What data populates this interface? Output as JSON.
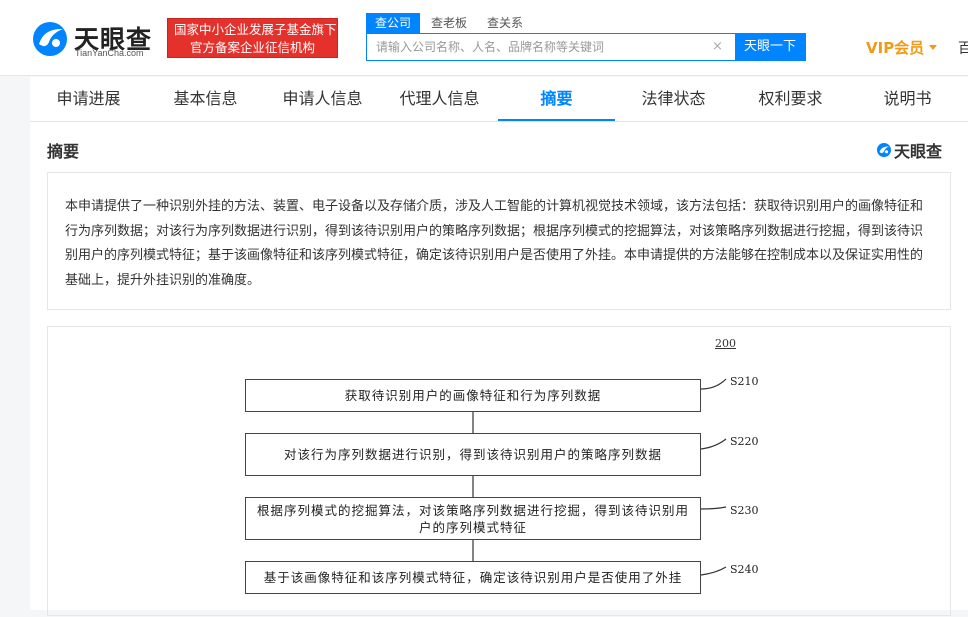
{
  "header": {
    "logo_text": "天眼查",
    "logo_domain": "TianYanCha.com",
    "fund_badge_line1": "国家中小企业发展子基金旗下",
    "fund_badge_line2": "官方备案企业征信机构",
    "search_tabs": [
      "查公司",
      "查老板",
      "查关系"
    ],
    "search_placeholder": "请输入公司名称、人名、品牌名称等关键词",
    "search_clear": "×",
    "search_button": "天眼一下",
    "vip_label": "VIP会员",
    "edge_char": "百"
  },
  "nav": {
    "tabs": [
      "申请进展",
      "基本信息",
      "申请人信息",
      "代理人信息",
      "摘要",
      "法律状态",
      "权利要求",
      "说明书"
    ],
    "active_index": 4
  },
  "section": {
    "title": "摘要",
    "watermark": "天眼查"
  },
  "abstract": {
    "text": "本申请提供了一种识别外挂的方法、装置、电子设备以及存储介质，涉及人工智能的计算机视觉技术领域，该方法包括：获取待识别用户的画像特征和行为序列数据；对该行为序列数据进行识别，得到该待识别用户的策略序列数据；根据序列模式的挖掘算法，对该策略序列数据进行挖掘，得到该待识别用户的序列模式特征；基于该画像特征和该序列模式特征，确定该待识别用户是否使用了外挂。本申请提供的方法能够在控制成本以及保证实用性的基础上，提升外挂识别的准确度。"
  },
  "figure": {
    "label": "200",
    "steps": [
      {
        "id": "S210",
        "text": "获取待识别用户的画像特征和行为序列数据"
      },
      {
        "id": "S220",
        "text": "对该行为序列数据进行识别，得到该待识别用户的策略序列数据"
      },
      {
        "id": "S230",
        "text": "根据序列模式的挖掘算法，对该策略序列数据进行挖掘，得到该待识别用户的序列模式特征"
      },
      {
        "id": "S240",
        "text": "基于该画像特征和该序列模式特征，确定该待识别用户是否使用了外挂"
      }
    ]
  },
  "colors": {
    "accent": "#0084ff",
    "badge_red": "#e5312c",
    "vip_orange": "#f09b18"
  }
}
